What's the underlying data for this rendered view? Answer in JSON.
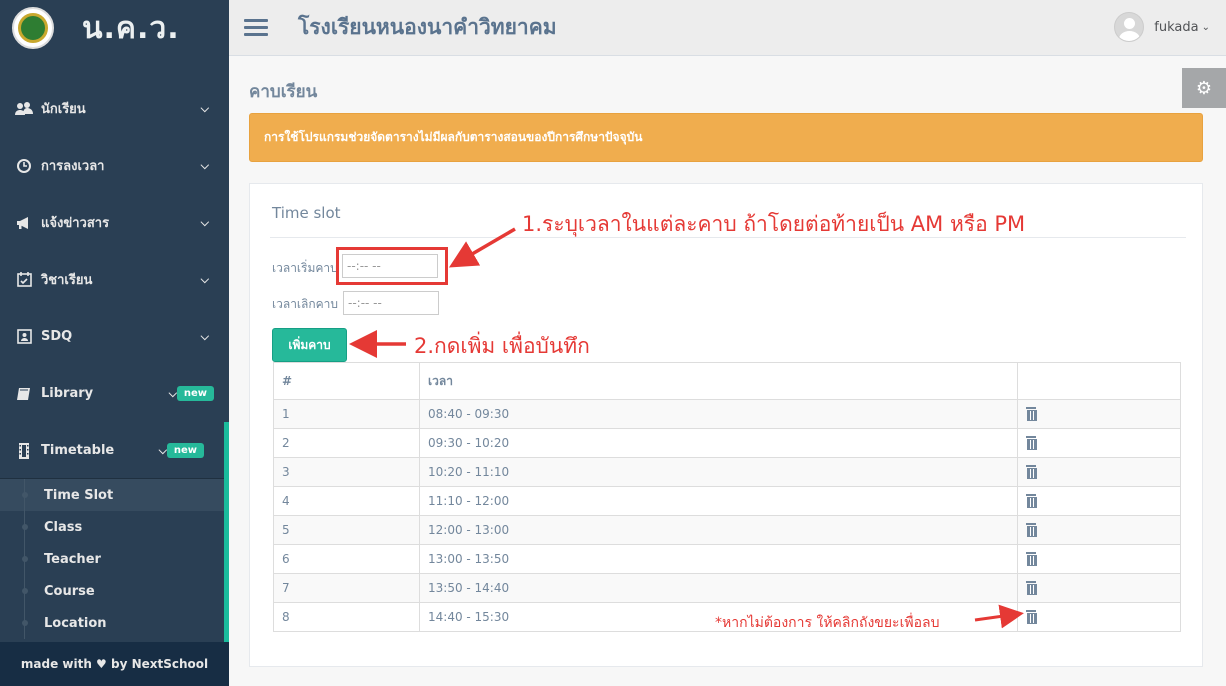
{
  "brand": {
    "name": "น.ค.ว."
  },
  "sidebar": {
    "items": [
      {
        "label": "นักเรียน",
        "icon": "users-icon"
      },
      {
        "label": "การลงเวลา",
        "icon": "clock-icon"
      },
      {
        "label": "แจ้งข่าวสาร",
        "icon": "bullhorn-icon"
      },
      {
        "label": "วิชาเรียน",
        "icon": "calendar-check-icon"
      },
      {
        "label": "SDQ",
        "icon": "id-card-icon"
      },
      {
        "label": "Library",
        "icon": "book-icon",
        "badge": "new"
      },
      {
        "label": "Timetable",
        "icon": "film-icon",
        "badge": "new"
      }
    ],
    "subitems": [
      "Time Slot",
      "Class",
      "Teacher",
      "Course",
      "Location"
    ],
    "footer": "made with ♥ by NextSchool"
  },
  "header": {
    "school": "โรงเรียนหนองนาคำวิทยาคม",
    "user": "fukada"
  },
  "main": {
    "page_title": "คาบเรียน",
    "alert": "การใช้โปรแกรมช่วยจัดตารางไม่มีผลกับตารางสอนของปีการศึกษาปัจจุบัน",
    "panel_title": "Time slot",
    "start_label": "เวลาเริ่มคาบ",
    "end_label": "เวลาเลิกคาบ",
    "time_placeholder": "--:-- --",
    "add_button": "เพิ่มคาบ",
    "table": {
      "headers": [
        "#",
        "เวลา",
        ""
      ],
      "rows": [
        {
          "num": "1",
          "time": "08:40 - 09:30"
        },
        {
          "num": "2",
          "time": "09:30 - 10:20"
        },
        {
          "num": "3",
          "time": "10:20 - 11:10"
        },
        {
          "num": "4",
          "time": "11:10 - 12:00"
        },
        {
          "num": "5",
          "time": "12:00 - 13:00"
        },
        {
          "num": "6",
          "time": "13:00 - 13:50"
        },
        {
          "num": "7",
          "time": "13:50 - 14:40"
        },
        {
          "num": "8",
          "time": "14:40 - 15:30"
        }
      ]
    }
  },
  "annotations": {
    "step1": "1.ระบุเวลาในแต่ละคาบ ถ้าโดยต่อท้ายเป็น AM หรือ PM",
    "step2": "2.กดเพิ่ม เพื่อบันทึก",
    "note": "*หากไม่ต้องการ ให้คลิกถังขยะเพื่อลบ"
  },
  "colors": {
    "sidebar": "#2A3F54",
    "accent": "#26B99A",
    "alert": "#F0AD4E",
    "annotation": "#E53935"
  }
}
